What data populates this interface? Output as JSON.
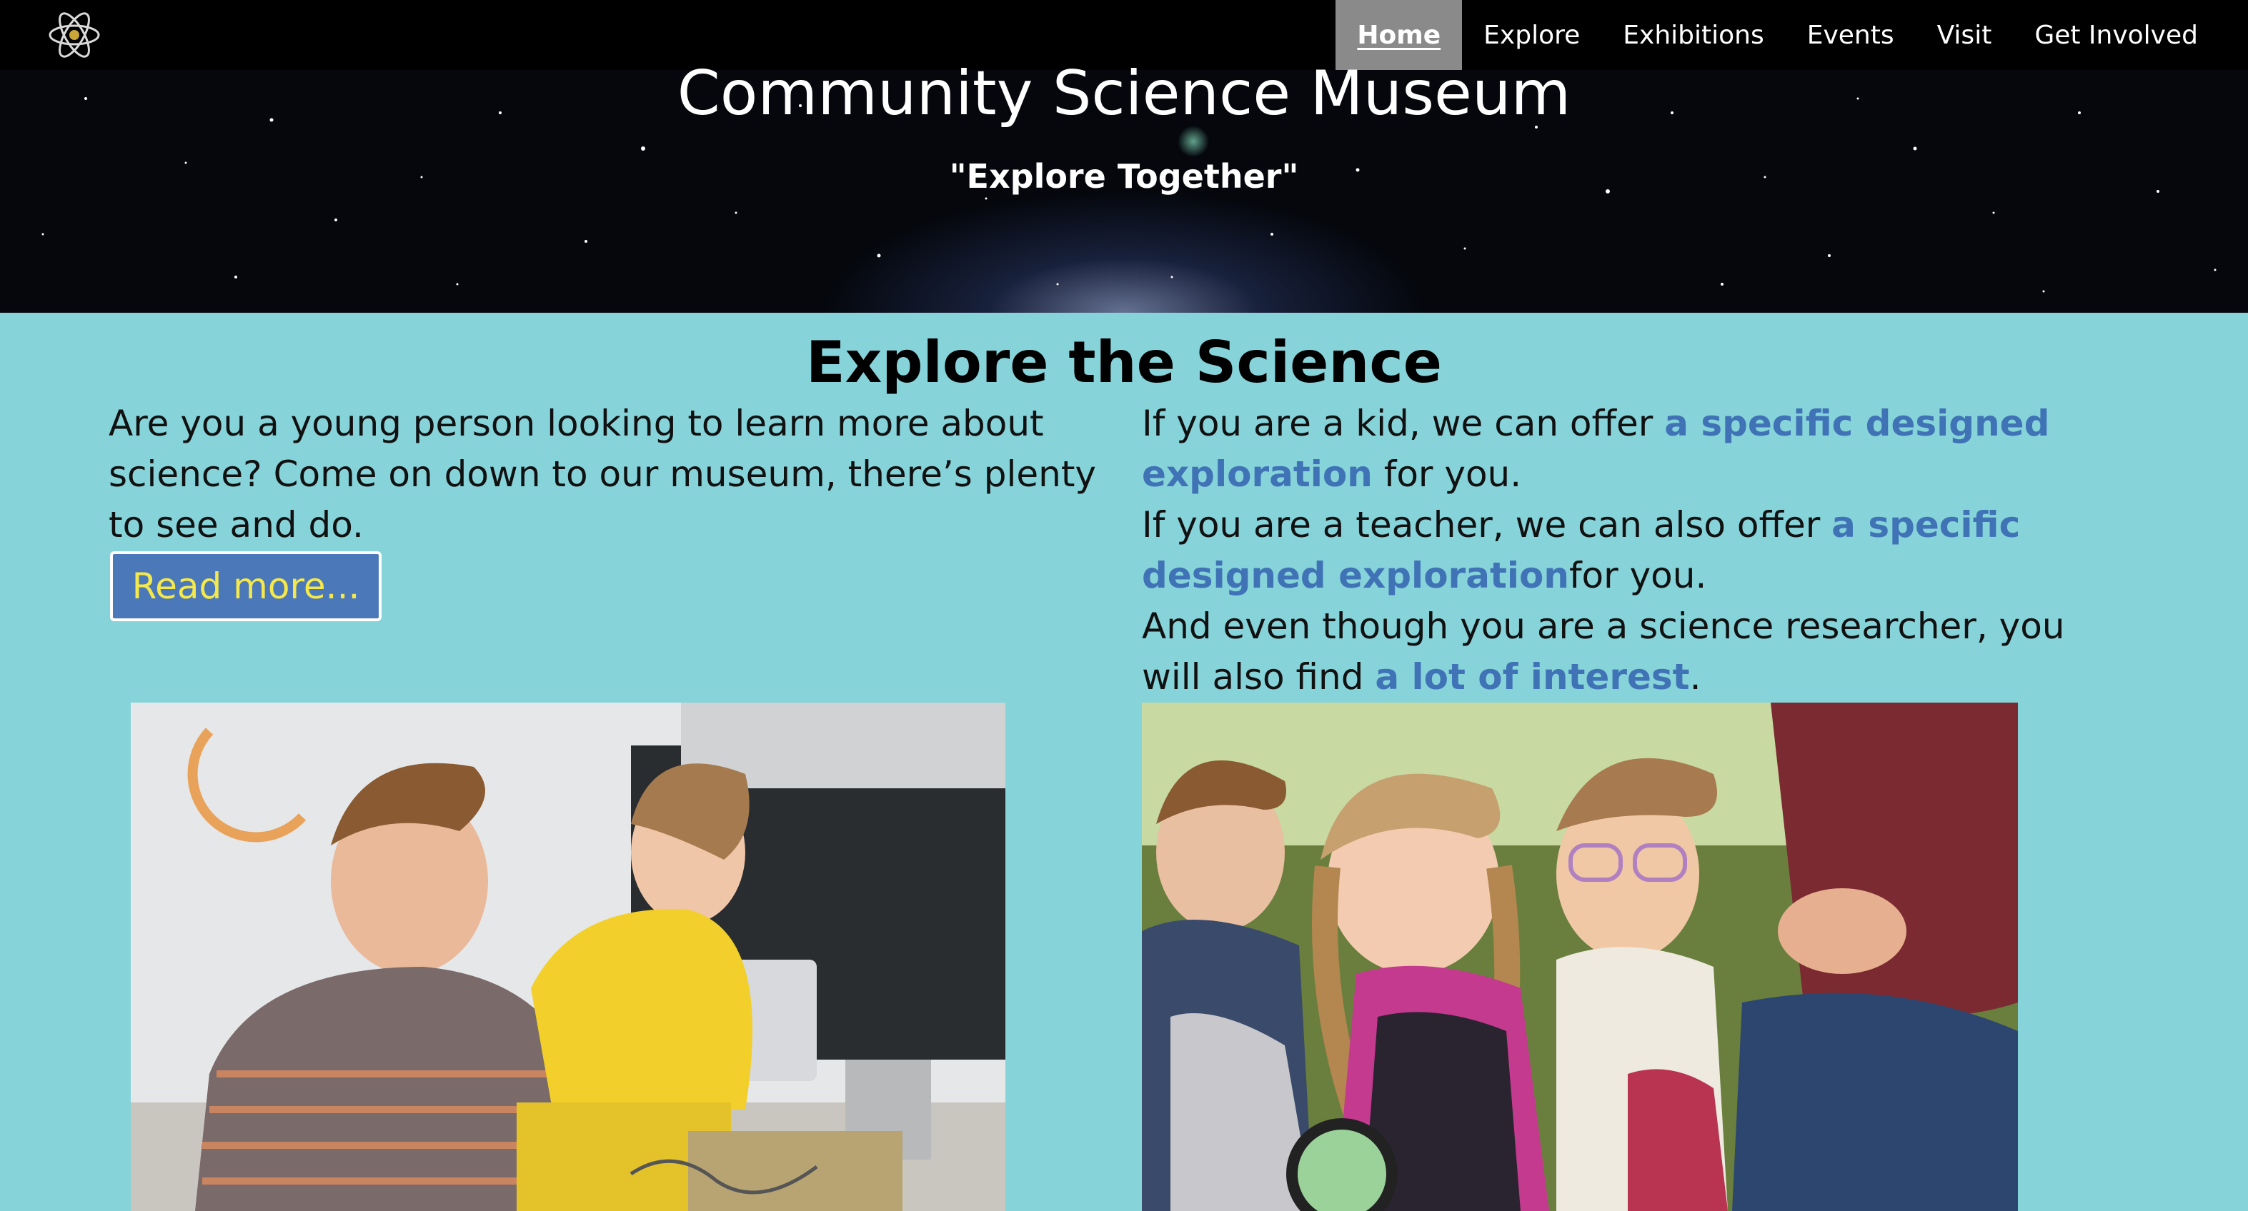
{
  "nav": {
    "logo": "atom-logo",
    "items": [
      {
        "label": "Home",
        "active": true
      },
      {
        "label": "Explore",
        "active": false
      },
      {
        "label": "Exhibitions",
        "active": false
      },
      {
        "label": "Events",
        "active": false
      },
      {
        "label": "Visit",
        "active": false
      },
      {
        "label": "Get Involved",
        "active": false
      }
    ]
  },
  "hero": {
    "title": "Community Science Museum",
    "tagline": "\"Explore Together\""
  },
  "main": {
    "heading": "Explore the Science",
    "left_text": "Are you a young person looking to learn more about science? Come on down to our museum, there’s plenty to see and do.",
    "read_more_label": "Read more...",
    "right": {
      "kid_pre": "If you are a kid, we can offer ",
      "kid_link": "a specific designed exploration",
      "kid_post": " for you.",
      "teacher_pre": "If you are a teacher, we can also offer ",
      "teacher_link": "a specific designed exploration",
      "teacher_post": "for you.",
      "researcher_pre": "And even though you are a science researcher, you will also find ",
      "researcher_link": "a lot of interest",
      "researcher_post": "."
    }
  },
  "colors": {
    "background": "#87d3da",
    "link": "#3f73b6",
    "button": "#4a78b8",
    "button_text": "#f5e84a"
  }
}
